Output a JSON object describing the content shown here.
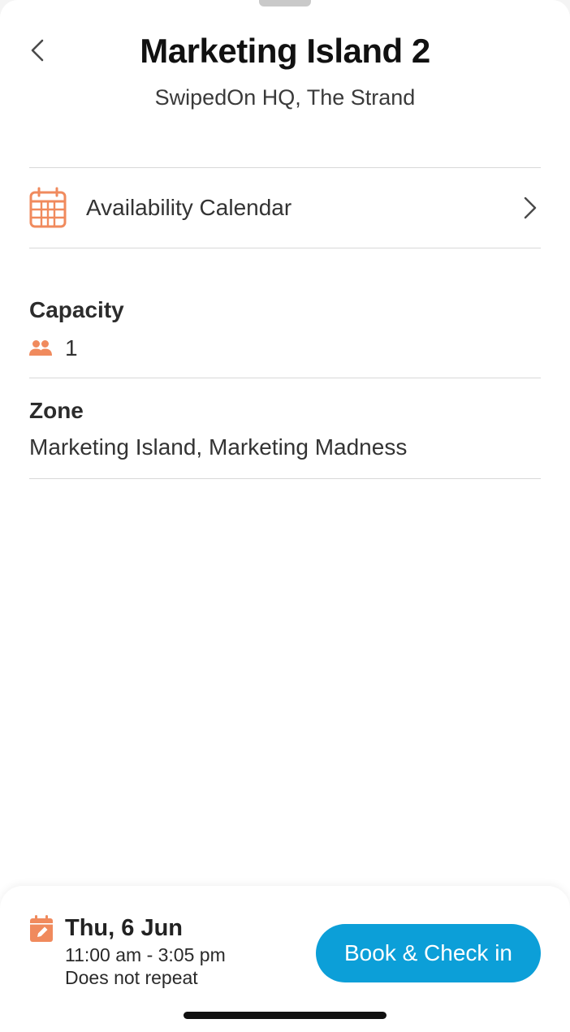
{
  "header": {
    "title": "Marketing Island 2",
    "subtitle": "SwipedOn HQ, The Strand"
  },
  "calendar_link": {
    "label": "Availability Calendar",
    "icon": "calendar-icon"
  },
  "capacity": {
    "heading": "Capacity",
    "value": "1",
    "icon": "people-icon"
  },
  "zone": {
    "heading": "Zone",
    "value": "Marketing Island, Marketing Madness"
  },
  "booking": {
    "date": "Thu, 6 Jun",
    "time": "11:00 am - 3:05 pm",
    "repeat": "Does not repeat",
    "button_label": "Book & Check in",
    "icon": "calendar-edit-icon"
  },
  "colors": {
    "accent_orange": "#F08A5D",
    "button_blue": "#0C9FD8"
  }
}
